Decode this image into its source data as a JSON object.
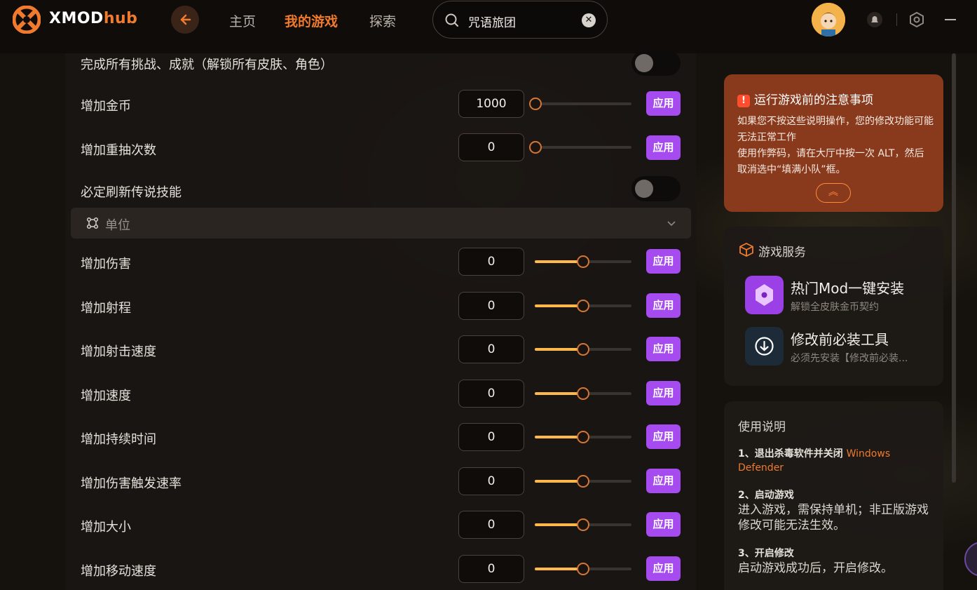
{
  "header": {
    "brand_a": "XMOD",
    "brand_b": "hub",
    "nav": [
      "主页",
      "我的游戏",
      "探索"
    ],
    "active_nav": "我的游戏",
    "search_value": "咒语旅团"
  },
  "mods": {
    "top_toggle_label": "完成所有挑战、成就（解锁所有皮肤、角色）",
    "gold_label": "增加金币",
    "gold_value": "1000",
    "reroll_label": "增加重抽次数",
    "reroll_value": "0",
    "legend_label": "必定刷新传说技能",
    "apply_label": "应用",
    "section_title": "单位",
    "unit_rows": [
      {
        "label": "增加伤害",
        "value": "0"
      },
      {
        "label": "增加射程",
        "value": "0"
      },
      {
        "label": "增加射击速度",
        "value": "0"
      },
      {
        "label": "增加速度",
        "value": "0"
      },
      {
        "label": "增加持续时间",
        "value": "0"
      },
      {
        "label": "增加伤害触发速率",
        "value": "0"
      },
      {
        "label": "增加大小",
        "value": "0"
      },
      {
        "label": "增加移动速度",
        "value": "0"
      }
    ],
    "slider_level_unit_rows": 0.5,
    "slider_level_gold": 0,
    "slider_level_reroll": 0,
    "toggle_states": [
      false,
      false
    ]
  },
  "notice": {
    "title": "运行游戏前的注意事项",
    "line1": "如果您不按这些说明操作，您的修改功能可能无法正常工作",
    "line2": "使用作弊码，请在大厅中按一次 ALT，然后取消选中“填满小队”框。",
    "collapse_symbol": "︽"
  },
  "services": {
    "title": "游戏服务",
    "items": [
      {
        "title": "热门Mod一键安装",
        "subtitle": "解锁全皮肤金币契约"
      },
      {
        "title": "修改前必装工具",
        "subtitle": "必须先安装【修改前必装..."
      }
    ]
  },
  "help": {
    "title": "使用说明",
    "step1_head": "1、退出杀毒软件并关闭",
    "step1_highlight": "Windows Defender",
    "step2_head": "2、启动游戏",
    "step2_body": "进入游戏，需保持单机；非正版游戏修改可能无法生效。",
    "step3_head": "3、开启修改",
    "step3_body": "启动游戏成功后，开启修改。"
  },
  "colors": {
    "accent": "#f07a2e",
    "apply": "#a64bf0",
    "slider_fill": "#ffb84a",
    "notice_bg": "#8a3a1c"
  }
}
